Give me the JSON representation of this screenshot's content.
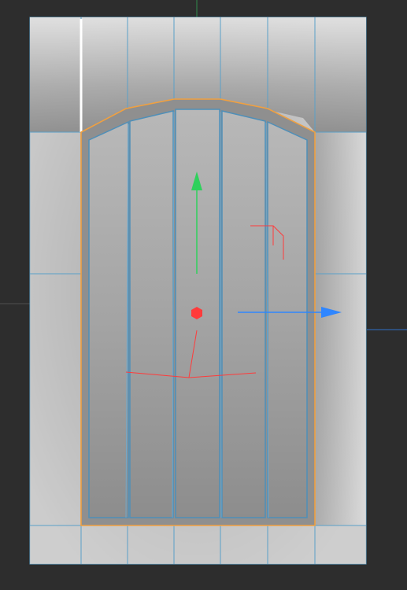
{
  "viewport": {
    "background": "#2d2d2d",
    "tool": "move-gizmo",
    "selection": "inner-panel-border",
    "selection_color": "#f0a040",
    "wireframe_color": "#5aa0c8"
  },
  "icons": [
    "y-axis-arrow-icon",
    "x-axis-arrow-icon",
    "pivot-point-icon",
    "plane-handle-icon"
  ],
  "colors": {
    "axis_y": "#2fd15c",
    "axis_x": "#2f86ff",
    "axis_z": "#ff3b3b",
    "model_light": "#d5d5d5",
    "model_dark": "#8e8e8e"
  }
}
